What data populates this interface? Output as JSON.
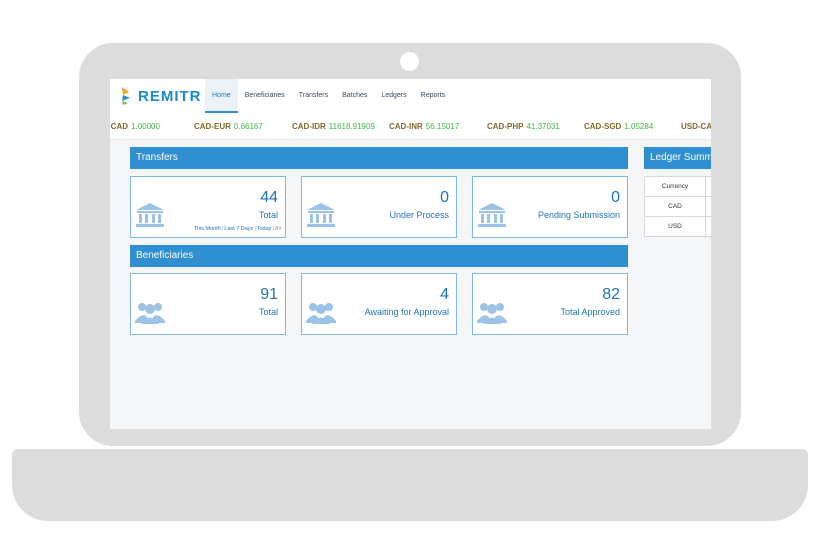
{
  "brand": {
    "name": "REMITR"
  },
  "nav": {
    "items": [
      {
        "label": "Home",
        "active": true
      },
      {
        "label": "Beneficiaries",
        "active": false
      },
      {
        "label": "Transfers",
        "active": false
      },
      {
        "label": "Batches",
        "active": false
      },
      {
        "label": "Ledgers",
        "active": false
      },
      {
        "label": "Reports",
        "active": false
      }
    ]
  },
  "ticker": [
    {
      "pair": "-CAD",
      "rate": "1.00000"
    },
    {
      "pair": "CAD-EUR",
      "rate": "0.66167"
    },
    {
      "pair": "CAD-IDR",
      "rate": "11618.91909"
    },
    {
      "pair": "CAD-INR",
      "rate": "56.15017"
    },
    {
      "pair": "CAD-PHP",
      "rate": "41.37031"
    },
    {
      "pair": "CAD-SGD",
      "rate": "1.05284"
    },
    {
      "pair": "USD-CA",
      "rate": ""
    }
  ],
  "transfers": {
    "title": "Transfers",
    "cards": [
      {
        "value": "44",
        "label": "Total",
        "icon": "bank-icon"
      },
      {
        "value": "0",
        "label": "Under Process",
        "icon": "bank-icon"
      },
      {
        "value": "0",
        "label": "Pending Submission",
        "icon": "bank-icon"
      }
    ],
    "filters": [
      "This Month",
      "Last 7 Days",
      "Today",
      "All"
    ]
  },
  "beneficiaries": {
    "title": "Beneficiaries",
    "cards": [
      {
        "value": "91",
        "label": "Total",
        "icon": "users-icon"
      },
      {
        "value": "4",
        "label": "Awaiting for Approval",
        "icon": "users-icon"
      },
      {
        "value": "82",
        "label": "Total Approved",
        "icon": "users-icon"
      }
    ]
  },
  "ledger": {
    "title": "Ledger Summary",
    "header": "Currency",
    "rows": [
      "CAD",
      "USD"
    ]
  },
  "colors": {
    "accent": "#2f8fd0",
    "card_text": "#1f73b7",
    "ticker_pair": "#7e6a2c",
    "ticker_rate": "#41b541",
    "frame": "#dcdcdc"
  }
}
